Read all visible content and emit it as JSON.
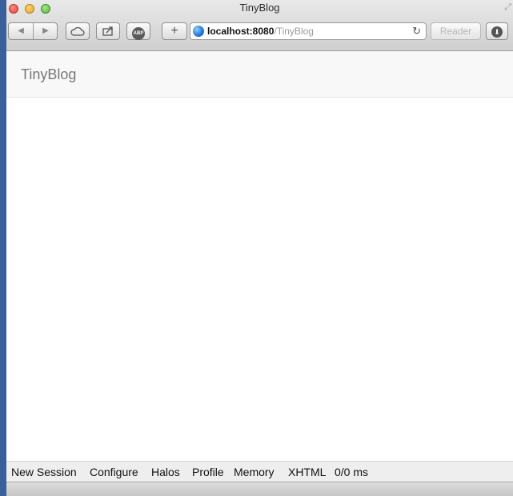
{
  "window": {
    "title": "TinyBlog"
  },
  "toolbar": {
    "back_icon": "back-arrow-icon",
    "forward_icon": "forward-arrow-icon",
    "icloud_icon": "cloud-icon",
    "share_icon": "share-icon",
    "adblock_label": "ABP",
    "new_tab_label": "+",
    "reader_label": "Reader"
  },
  "address_bar": {
    "host": "localhost:8080",
    "path": "/TinyBlog"
  },
  "page": {
    "brand": "TinyBlog"
  },
  "dev_toolbar": {
    "items": [
      {
        "label": "New Session"
      },
      {
        "label": "Configure"
      },
      {
        "label": "Halos"
      },
      {
        "label": "Profile"
      },
      {
        "label": "Memory"
      },
      {
        "label": "XHTML"
      },
      {
        "label": "0/0 ms"
      }
    ]
  }
}
